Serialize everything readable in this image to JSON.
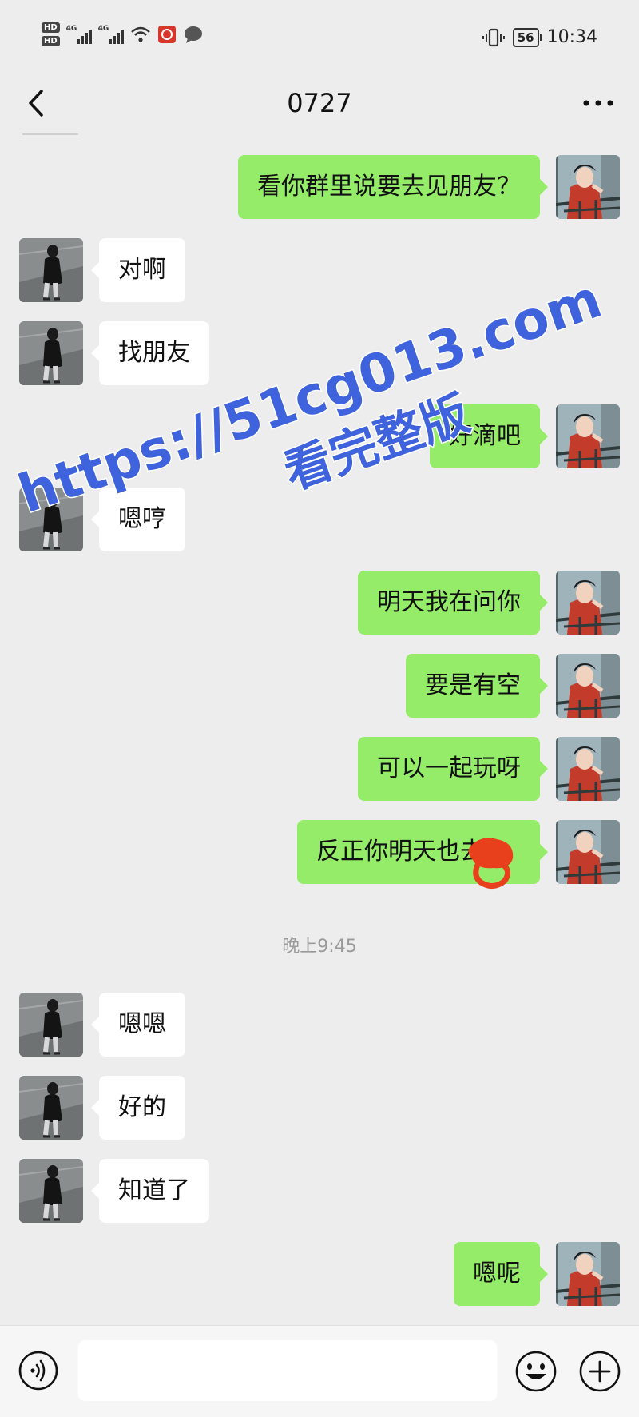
{
  "status_bar": {
    "hd_1": "HD",
    "hd_2": "HD",
    "network_1": "4G",
    "network_2": "4G",
    "battery": "56",
    "time": "10:34"
  },
  "header": {
    "title": "0727"
  },
  "messages": [
    {
      "side": "right",
      "text": "看你群里说要去见朋友？"
    },
    {
      "side": "left",
      "text": "对啊"
    },
    {
      "side": "left",
      "text": "找朋友"
    },
    {
      "side": "right",
      "text": "好滴吧"
    },
    {
      "side": "left",
      "text": "嗯哼"
    },
    {
      "side": "right",
      "text": "明天我在问你"
    },
    {
      "side": "right",
      "text": "要是有空"
    },
    {
      "side": "right",
      "text": "可以一起玩呀"
    },
    {
      "side": "right",
      "text": "反正你明天也去"
    },
    {
      "side": "left",
      "text": "嗯嗯"
    },
    {
      "side": "left",
      "text": "好的"
    },
    {
      "side": "left",
      "text": "知道了"
    },
    {
      "side": "right",
      "text": "嗯呢"
    }
  ],
  "timestamp": "晚上9:45",
  "watermark": {
    "line1": "https://51cg013.com",
    "line2": "看完整版"
  },
  "input_bar": {
    "placeholder": ""
  },
  "colors": {
    "background": "#ededed",
    "outgoing_bubble": "#95ec69",
    "incoming_bubble": "#ffffff",
    "watermark": "#3f63dc",
    "redaction": "#e8401c"
  },
  "icons": {
    "back": "chevron-left-icon",
    "more": "more-icon",
    "voice": "voice-icon",
    "emoji": "emoji-icon",
    "plus": "plus-icon"
  }
}
